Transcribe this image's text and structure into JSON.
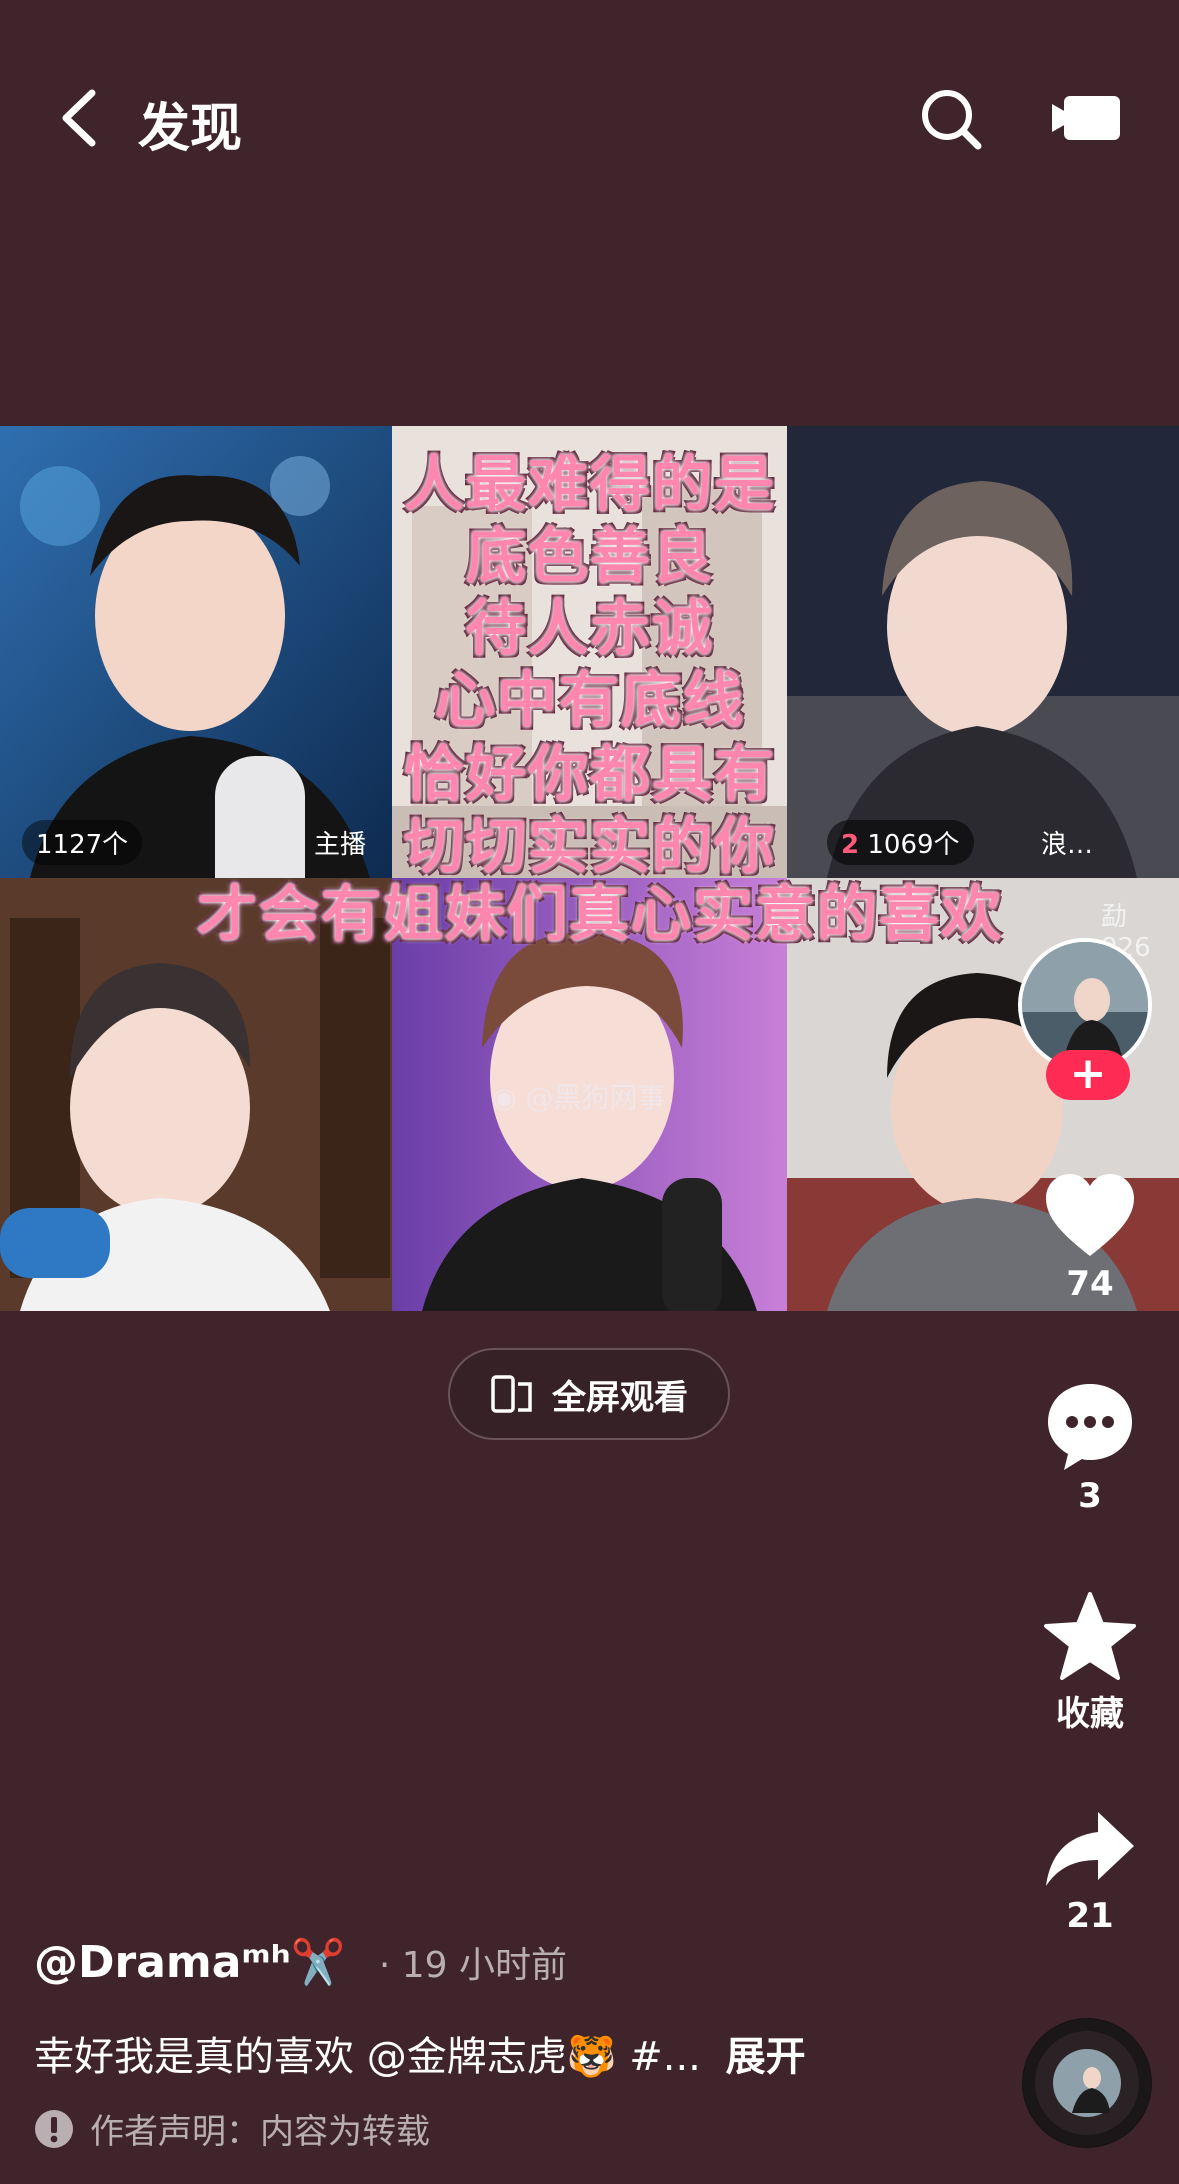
{
  "header": {
    "title": "发现",
    "back_icon": "chevron-left-icon",
    "search_icon": "search-icon",
    "video_icon": "video-camera-icon"
  },
  "video": {
    "caption_lines": [
      "人最难得的是",
      "底色善良",
      "待人赤诚",
      "心中有底线",
      "恰好你都具有",
      "切切实实的你",
      "才会有姐妹们真心实意的喜欢"
    ],
    "tile_labels": {
      "left_count": "1127个",
      "left_tag": "主播",
      "right_rank": "2",
      "right_count": "1069个",
      "right_tag": "浪…",
      "bottom_right_tag": "勐926"
    },
    "watermark": "@黑狗网事"
  },
  "fullscreen": {
    "label": "全屏观看",
    "icon": "rotate-screen-icon"
  },
  "actions": {
    "like_count": "74",
    "comment_count": "3",
    "favorite_label": "收藏",
    "share_count": "21",
    "follow_symbol": "+"
  },
  "post": {
    "author": "@Dramaᵐʰ✂️",
    "time": "· 19 小时前",
    "description": "幸好我是真的喜欢 @金牌志虎🐯 #...",
    "expand": "展开",
    "declaration": "作者声明：内容为转载"
  },
  "colors": {
    "background": "#3f252b",
    "accent": "#fe2c55",
    "caption_pink": "#ff86ae"
  }
}
